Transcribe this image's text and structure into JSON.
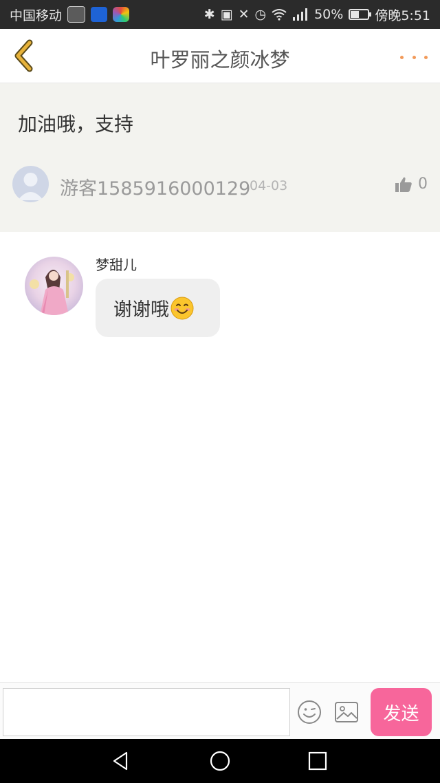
{
  "status_bar": {
    "carrier": "中国移动",
    "battery": "50%",
    "battery_level": 0.5,
    "time": "傍晚5:51",
    "icons": [
      "bluetooth-icon",
      "nfc-icon",
      "mute-icon",
      "alarm-icon",
      "wifi-icon",
      "signal-icon",
      "battery-icon"
    ]
  },
  "nav": {
    "title": "叶罗丽之颜冰梦",
    "back_icon": "chevron-left-icon",
    "more_icon": "more-dots-icon"
  },
  "post": {
    "text": "加油哦，支持",
    "username": "游客1585916000129",
    "date": "04-03",
    "likes": "0"
  },
  "reply": {
    "name": "梦甜儿",
    "message": "谢谢哦"
  },
  "input": {
    "placeholder": "",
    "send_label": "发送"
  },
  "colors": {
    "accent": "#f7669b",
    "back_icon": "#e7b23a",
    "more_dots": "#f29a5a",
    "post_bg": "#f3f3ef"
  }
}
